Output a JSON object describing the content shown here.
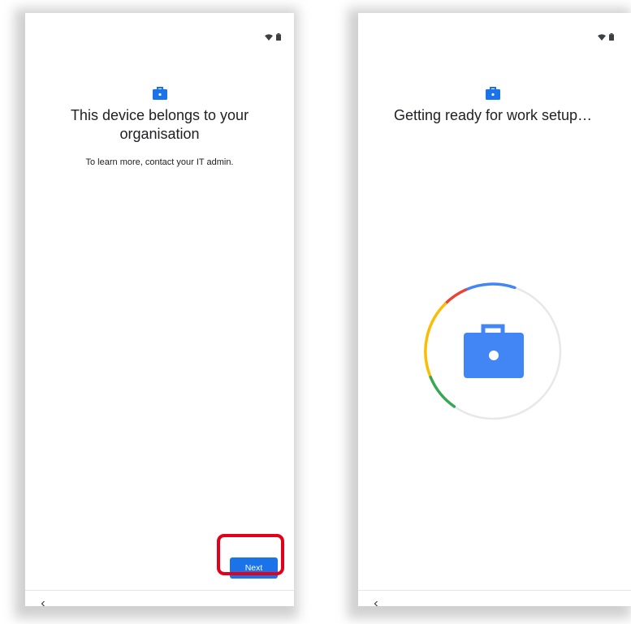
{
  "screens": [
    {
      "id": "ownership-notice",
      "headline_line1": "This device belongs to your",
      "headline_line2": "organisation",
      "subtext": "To learn more, contact your IT admin.",
      "next_label": "Next",
      "back_icon": "chevron-left-icon",
      "top_icon": "briefcase-icon",
      "status_icons": [
        "wifi-icon",
        "battery-icon"
      ]
    },
    {
      "id": "work-setup-progress",
      "headline": "Getting ready for work setup…",
      "back_icon": "chevron-left-icon",
      "top_icon": "briefcase-icon",
      "center_icon": "briefcase-icon",
      "status_icons": [
        "wifi-icon",
        "battery-icon"
      ]
    }
  ],
  "colors": {
    "accent_blue": "#1a73e8",
    "briefcase_blue": "#4285f4",
    "highlight_red": "#e2001a",
    "google_red": "#ea4335",
    "google_yellow": "#fbbc04",
    "google_green": "#34a853",
    "ring_track": "#e8e8e8",
    "text_dark": "#202124"
  }
}
